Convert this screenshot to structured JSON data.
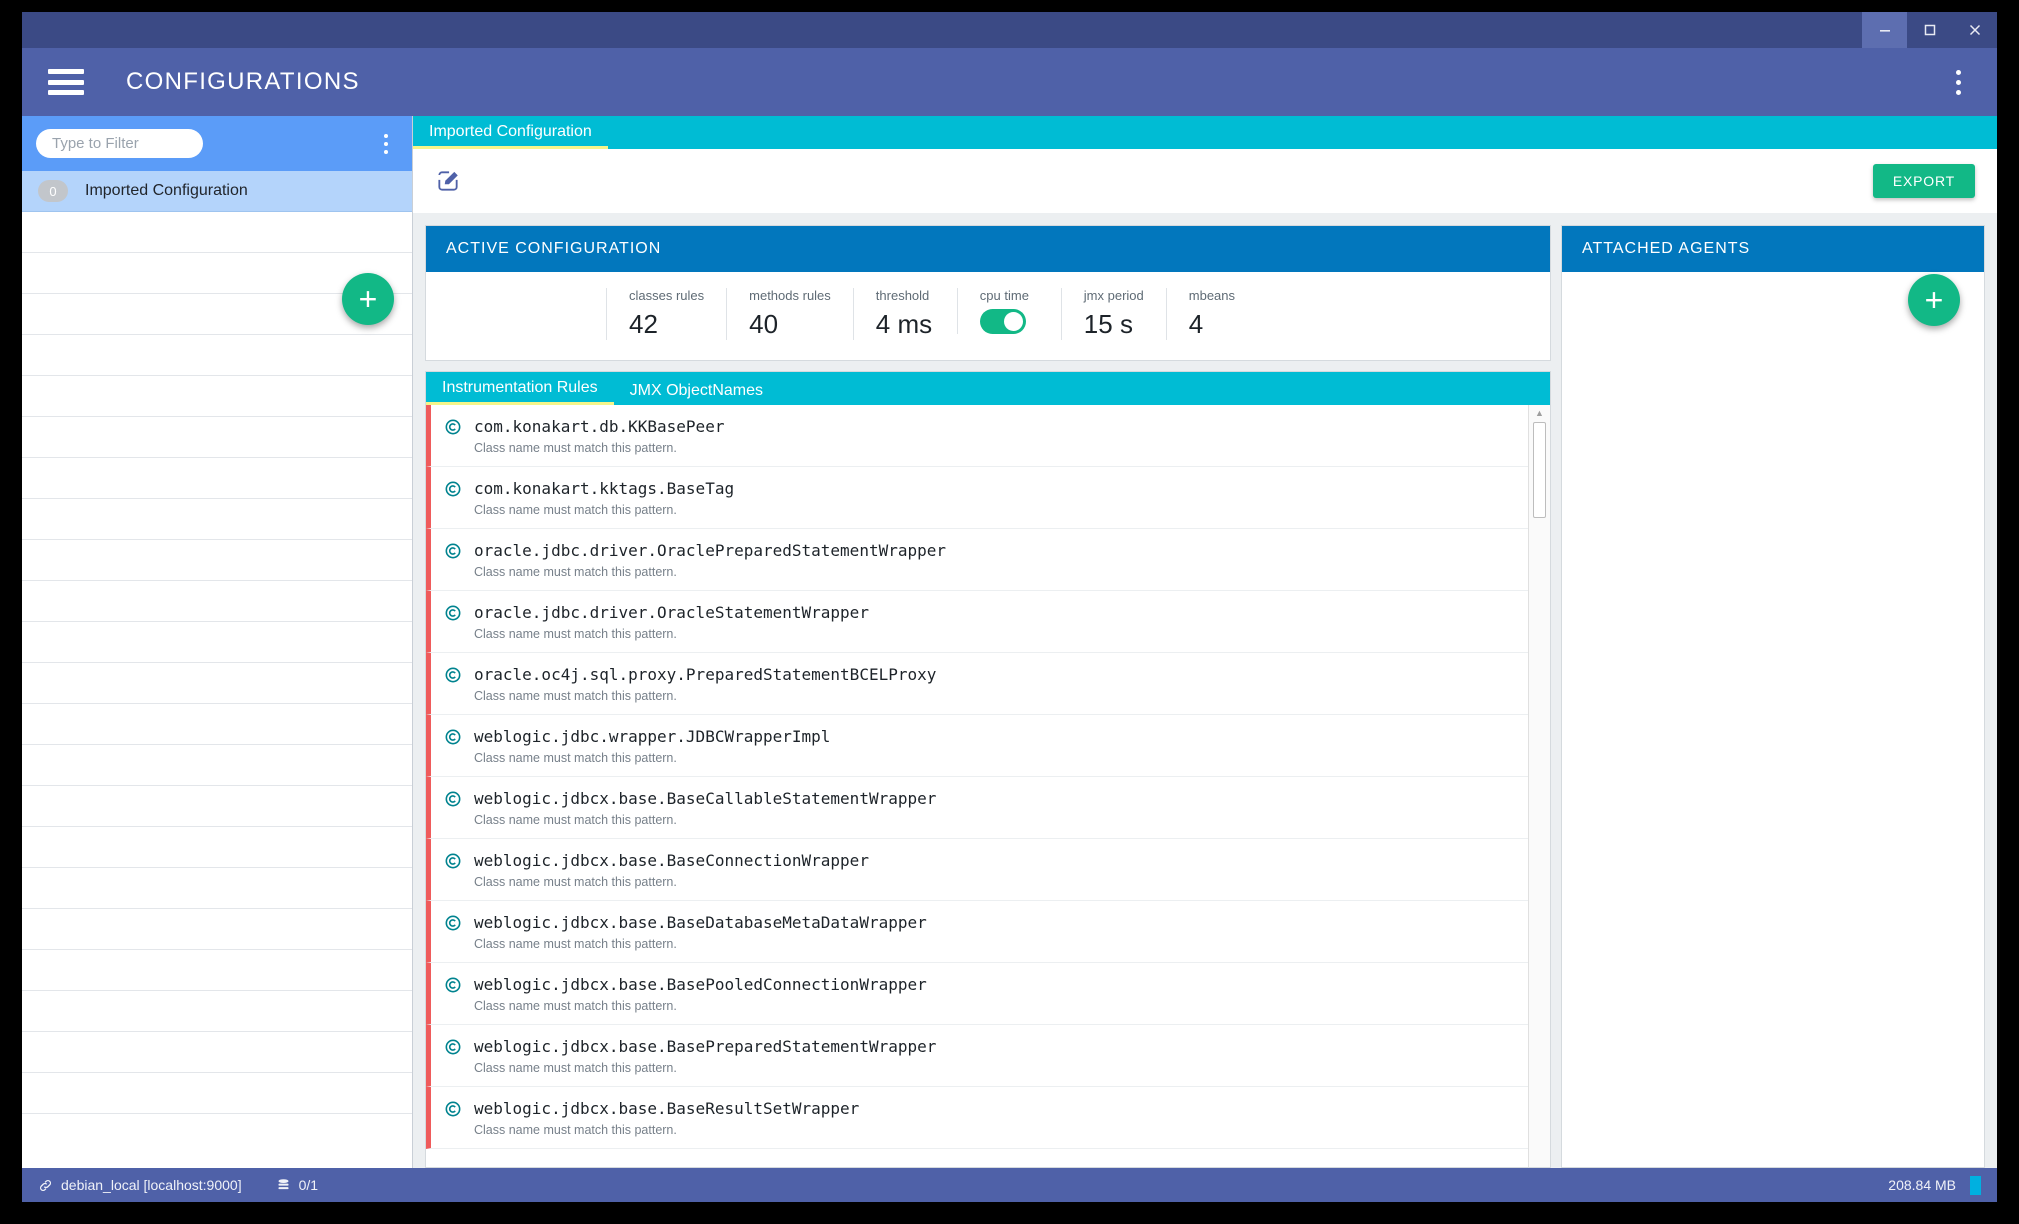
{
  "window": {
    "controls": [
      {
        "name": "minimize",
        "icon": "minimize-icon"
      },
      {
        "name": "maximize",
        "icon": "maximize-icon"
      },
      {
        "name": "close",
        "icon": "close-icon"
      }
    ]
  },
  "appbar": {
    "menu_icon": "hamburger-menu-icon",
    "title": "CONFIGURATIONS",
    "overflow_icon": "kebab-menu-icon"
  },
  "sidebar": {
    "filter_placeholder": "Type to Filter",
    "filter_value": "",
    "overflow_icon": "kebab-menu-icon",
    "add_label": "+",
    "items": [
      {
        "badge": "0",
        "label": "Imported Configuration",
        "selected": true
      }
    ],
    "empty_row_count": 22
  },
  "config_header": {
    "tab_label": "Imported Configuration"
  },
  "toolbar": {
    "edit_icon": "edit-pencil-icon",
    "export_label": "EXPORT"
  },
  "active_configuration": {
    "title": "ACTIVE CONFIGURATION",
    "stats": [
      {
        "label": "classes rules",
        "value": "42",
        "type": "text"
      },
      {
        "label": "methods rules",
        "value": "40",
        "type": "text"
      },
      {
        "label": "threshold",
        "value": "4 ms",
        "type": "text"
      },
      {
        "label": "cpu time",
        "value": "on",
        "type": "toggle"
      },
      {
        "label": "jmx period",
        "value": "15 s",
        "type": "text"
      },
      {
        "label": "mbeans",
        "value": "4",
        "type": "text"
      }
    ]
  },
  "rules": {
    "tabs": [
      {
        "label": "Instrumentation Rules",
        "active": true
      },
      {
        "label": "JMX ObjectNames",
        "active": false
      }
    ],
    "subtitle": "Class name must match this pattern.",
    "icon": "class-rule-icon",
    "items": [
      {
        "name": "com.konakart.db.KKBasePeer",
        "sub": "Class name must match this pattern."
      },
      {
        "name": "com.konakart.kktags.BaseTag",
        "sub": "Class name must match this pattern."
      },
      {
        "name": "oracle.jdbc.driver.OraclePreparedStatementWrapper",
        "sub": "Class name must match this pattern."
      },
      {
        "name": "oracle.jdbc.driver.OracleStatementWrapper",
        "sub": "Class name must match this pattern."
      },
      {
        "name": "oracle.oc4j.sql.proxy.PreparedStatementBCELProxy",
        "sub": "Class name must match this pattern."
      },
      {
        "name": "weblogic.jdbc.wrapper.JDBCWrapperImpl",
        "sub": "Class name must match this pattern."
      },
      {
        "name": "weblogic.jdbcx.base.BaseCallableStatementWrapper",
        "sub": "Class name must match this pattern."
      },
      {
        "name": "weblogic.jdbcx.base.BaseConnectionWrapper",
        "sub": "Class name must match this pattern."
      },
      {
        "name": "weblogic.jdbcx.base.BaseDatabaseMetaDataWrapper",
        "sub": "Class name must match this pattern."
      },
      {
        "name": "weblogic.jdbcx.base.BasePooledConnectionWrapper",
        "sub": "Class name must match this pattern."
      },
      {
        "name": "weblogic.jdbcx.base.BasePreparedStatementWrapper",
        "sub": "Class name must match this pattern."
      },
      {
        "name": "weblogic.jdbcx.base.BaseResultSetWrapper",
        "sub": "Class name must match this pattern."
      }
    ]
  },
  "attached_agents": {
    "title": "ATTACHED AGENTS",
    "add_label": "+",
    "items": []
  },
  "statusbar": {
    "connection_icon": "link-icon",
    "connection": "debian_local [localhost:9000]",
    "database_icon": "database-icon",
    "db_count": "0/1",
    "memory": "208.84 MB"
  },
  "colors": {
    "appbar": "#4f61a8",
    "titlebar": "#3b4a85",
    "sidebar_head": "#5b9cf8",
    "accent_teal": "#00bcd4",
    "card_head": "#0277bd",
    "fab_green": "#12b886",
    "rule_bar_red": "#ef5b5b",
    "tab_underline": "#f5f58a"
  }
}
